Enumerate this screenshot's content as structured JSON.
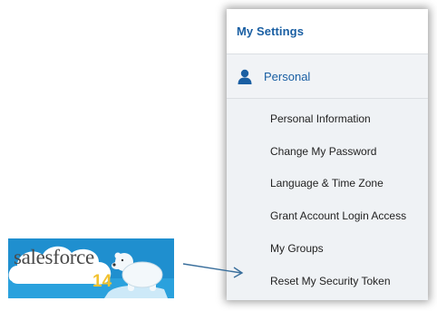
{
  "settings": {
    "title": "My Settings",
    "section": {
      "label": "Personal",
      "icon": "person-icon"
    },
    "items": [
      {
        "label": "Personal Information"
      },
      {
        "label": "Change My Password"
      },
      {
        "label": "Language & Time Zone"
      },
      {
        "label": "Grant Account Login Access"
      },
      {
        "label": "My Groups"
      },
      {
        "label": "Reset My Security Token"
      }
    ]
  },
  "logo": {
    "brand": "salesforce",
    "release_number": "14",
    "mascot_icon": "polar-bear-icon"
  },
  "colors": {
    "link_blue": "#1a5fa3",
    "logo_blue": "#1f8fcf",
    "logo_number": "#f2c230"
  }
}
